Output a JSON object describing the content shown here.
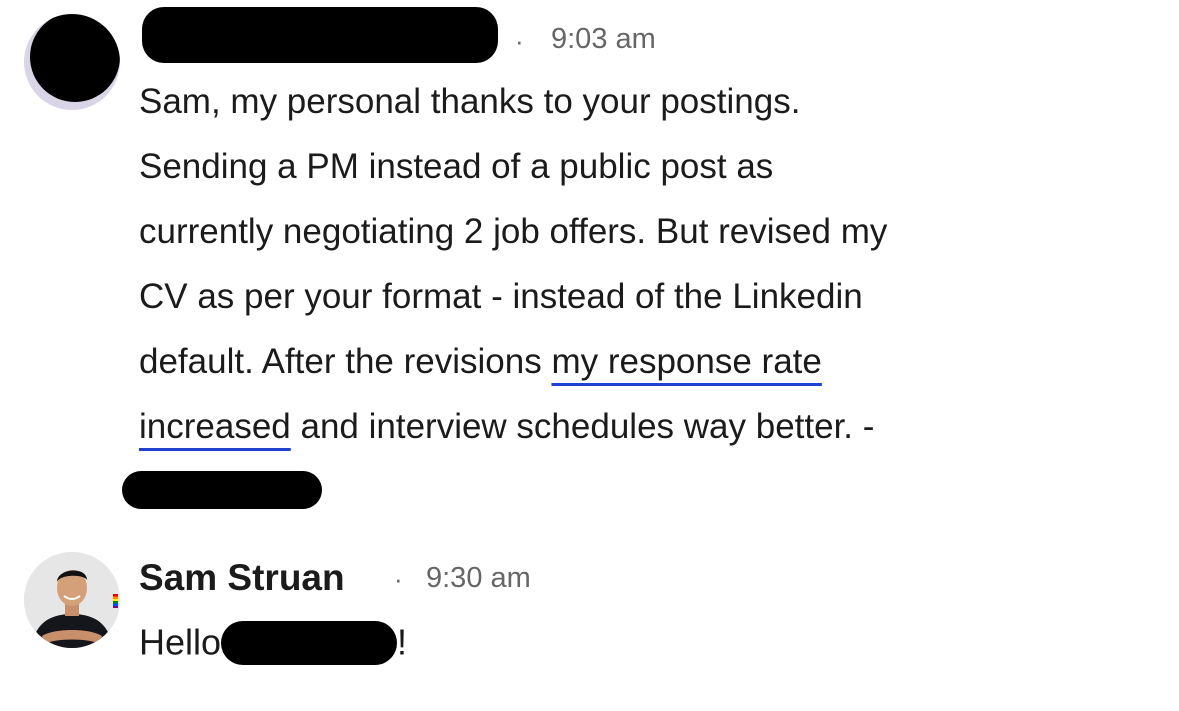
{
  "messages": [
    {
      "time": "9:03 am",
      "separator": "·",
      "lines": {
        "l1": "Sam, my personal thanks to your postings.",
        "l2": "Sending a PM instead of a public post as",
        "l3": "currently negotiating 2 job offers. But revised my",
        "l4": "CV as per your format - instead of the Linkedin",
        "l5_pre": "default.  After the revisions ",
        "l5_hl": "my response rate",
        "l6_hl": "increased",
        "l6_post": " and interview schedules way better.  -"
      }
    },
    {
      "sender": "Sam Struan",
      "separator": "·",
      "time": "9:30 am",
      "greeting_pre": "Hello",
      "greeting_post": "!"
    }
  ],
  "colors": {
    "highlight_underline": "#1f43d0",
    "timestamp": "#666666",
    "text": "#1b1b1b"
  }
}
